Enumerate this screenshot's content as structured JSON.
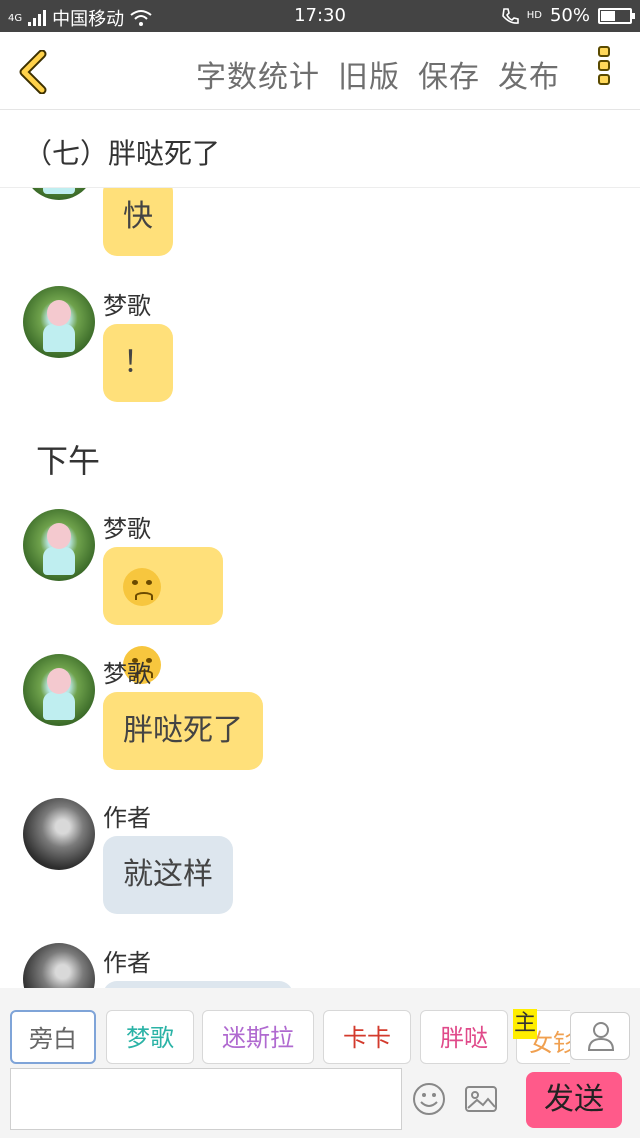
{
  "status_bar": {
    "network": "4G",
    "carrier": "中国移动",
    "time": "17:30",
    "hd": "HD",
    "battery": "50%",
    "battery_level": 0.5
  },
  "toolbar": {
    "back_icon": "chevron-left-icon",
    "actions": [
      "字数统计",
      "旧版",
      "保存",
      "发布"
    ],
    "more_icon": "more-vertical-icon"
  },
  "chapter": {
    "title": "（七）胖哒死了"
  },
  "messages": [
    {
      "avatar": "green",
      "name": "",
      "text": "快",
      "style": "yellow"
    },
    {
      "avatar": "green",
      "name": "梦歌",
      "text": "！",
      "style": "yellow"
    },
    {
      "type": "time",
      "text": "下午"
    },
    {
      "avatar": "green",
      "name": "梦歌",
      "emoji_count": 2,
      "style": "yellow"
    },
    {
      "avatar": "green",
      "name": "梦歌",
      "text": "胖哒死了",
      "style": "yellow"
    },
    {
      "avatar": "dark",
      "name": "作者",
      "text": "就这样",
      "style": "blue"
    },
    {
      "avatar": "dark",
      "name": "作者",
      "text": "",
      "style": "blue"
    }
  ],
  "roles": [
    {
      "label": "旁白",
      "color": "#666666",
      "active": true
    },
    {
      "label": "梦歌",
      "color": "#2bb3a6",
      "active": false
    },
    {
      "label": "迷斯拉",
      "color": "#b06ad0",
      "active": false
    },
    {
      "label": "卡卡",
      "color": "#d33a2c",
      "active": false
    },
    {
      "label": "胖哒",
      "color": "#e04a8a",
      "active": false
    },
    {
      "label": "女钐",
      "color": "#f0a050",
      "active": false
    }
  ],
  "role_badge": "主",
  "role_user_icon": "user-icon",
  "input": {
    "placeholder": "",
    "emoji_icon": "smiley-icon",
    "image_icon": "image-icon",
    "send_label": "发送"
  }
}
